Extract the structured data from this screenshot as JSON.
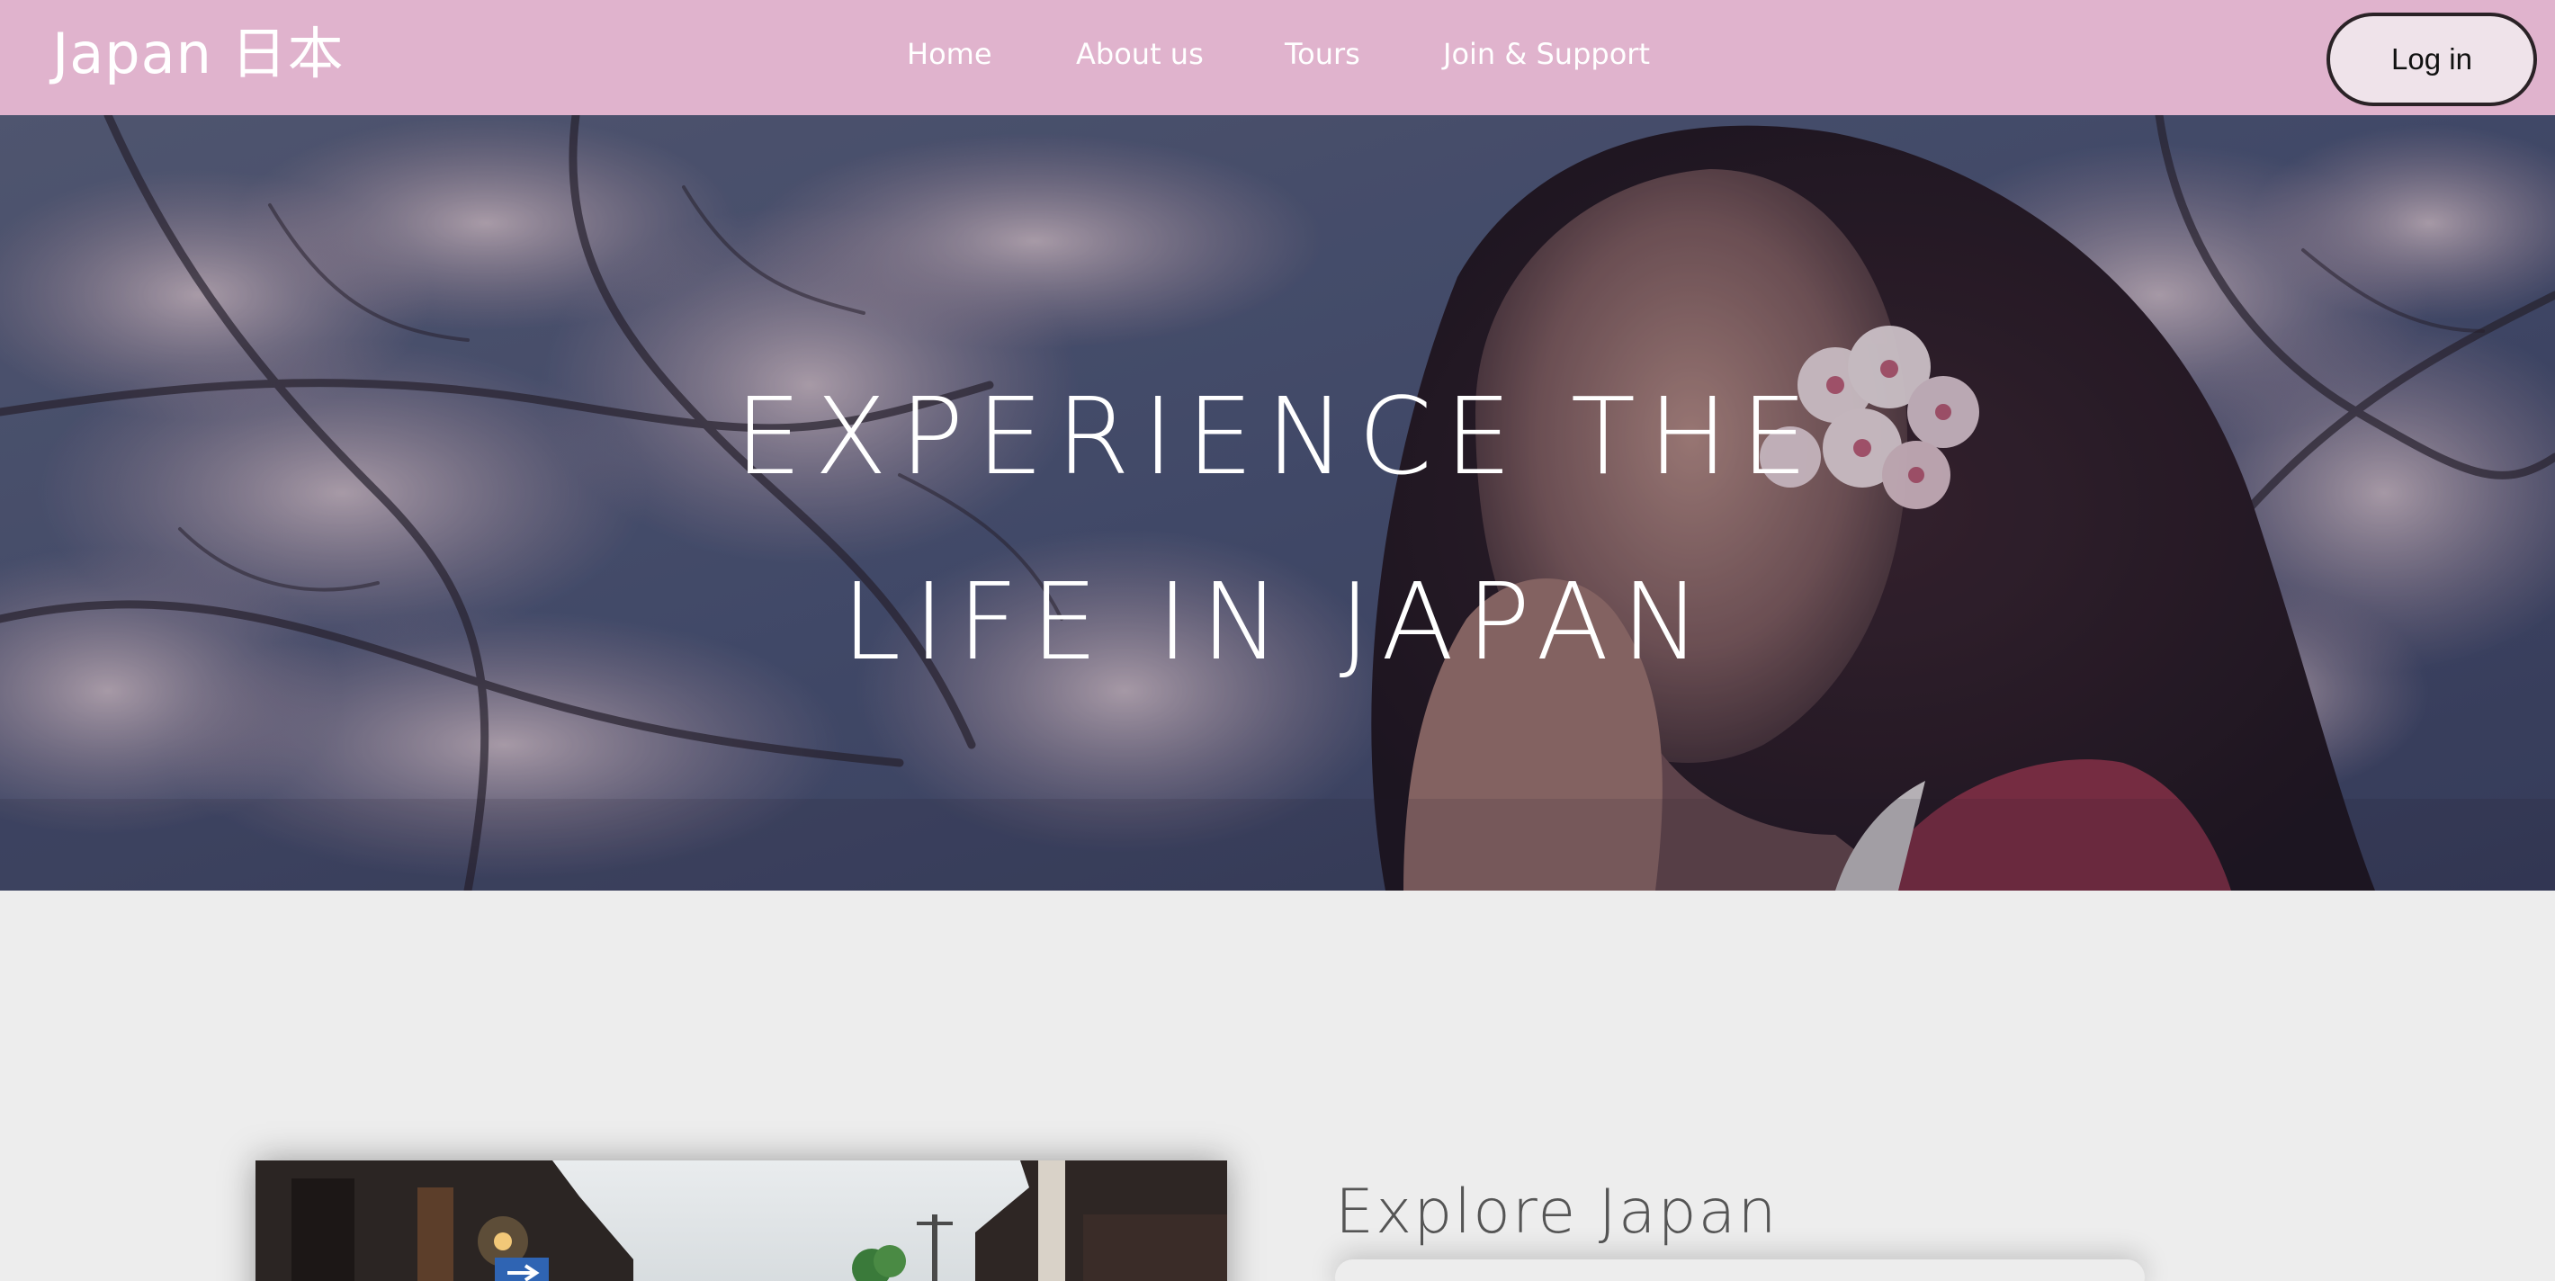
{
  "navbar": {
    "brand": "Japan 日本",
    "links": [
      {
        "label": "Home"
      },
      {
        "label": "About us"
      },
      {
        "label": "Tours"
      },
      {
        "label": "Join & Support"
      }
    ],
    "login_label": "Log in",
    "background_color": "#e0b3cd"
  },
  "hero": {
    "title_line1": "EXPERIENCE THE",
    "title_line2": "LIFE IN JAPAN"
  },
  "explore": {
    "heading": "Explore Japan"
  }
}
